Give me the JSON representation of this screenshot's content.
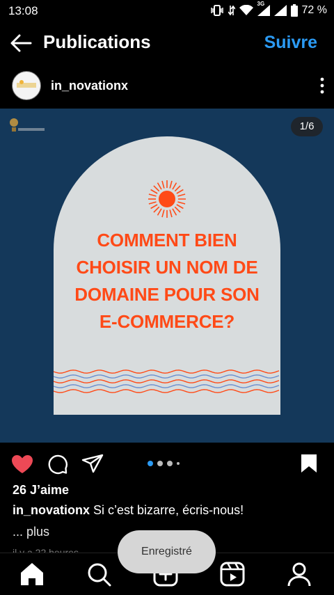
{
  "status_bar": {
    "time": "13:08",
    "network": "3G",
    "battery": "72 %"
  },
  "app_bar": {
    "title": "Publications",
    "follow_label": "Suivre"
  },
  "post": {
    "username": "in_novationx",
    "slide_counter": "1/6",
    "slide_count": 6,
    "current_slide": 1,
    "image_headline": [
      "COMMENT BIEN",
      "CHOISIR UN NOM DE",
      "DOMAINE POUR SON",
      "E-COMMERCE?"
    ],
    "liked": true,
    "likes": "26 J’aime",
    "caption_text": "Si c’est bizarre, écris-nous!",
    "more_label": "... plus",
    "time": "il y a 22 heures"
  },
  "toast": "Enregistré",
  "colors": {
    "accent": "#2b9af3",
    "like": "#ed4956",
    "image_background": "#14385a",
    "headline": "#ff4a17",
    "wave_blue": "#6a8fd0"
  },
  "bottom_nav": {
    "items": [
      "home-icon",
      "search-icon",
      "create-icon",
      "reels-icon",
      "profile-icon"
    ]
  }
}
